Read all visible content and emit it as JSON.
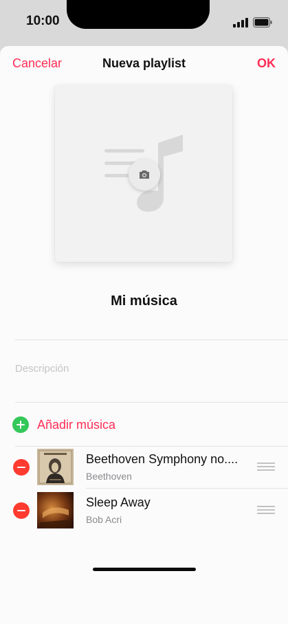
{
  "status_bar": {
    "time": "10:00"
  },
  "nav": {
    "cancel_label": "Cancelar",
    "title": "Nueva playlist",
    "ok_label": "OK"
  },
  "playlist": {
    "name": "Mi música",
    "description_placeholder": "Descripción"
  },
  "add_music": {
    "label": "Añadir música"
  },
  "tracks": [
    {
      "title": "Beethoven Symphony no....",
      "artist": "Beethoven"
    },
    {
      "title": "Sleep Away",
      "artist": "Bob Acri"
    }
  ],
  "colors": {
    "accent": "#ff2d55",
    "add": "#34c759",
    "remove": "#ff3b30"
  },
  "icons": [
    "signal-icon",
    "battery-icon",
    "music-note-icon",
    "camera-icon",
    "add-icon",
    "remove-icon",
    "reorder-icon"
  ]
}
